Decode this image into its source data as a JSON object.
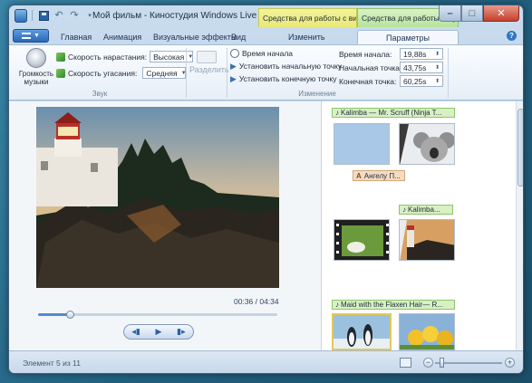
{
  "window": {
    "title": "Мой фильм - Киностудия Windows Live",
    "context_tabs": {
      "video_tools": "Средства для работы с видео",
      "music_tools": "Средства для работы с муз..."
    }
  },
  "tabs": [
    {
      "label": "Главная",
      "active": false
    },
    {
      "label": "Анимация",
      "active": false
    },
    {
      "label": "Визуальные эффекты",
      "active": false
    },
    {
      "label": "Вид",
      "active": false
    },
    {
      "label": "Изменить",
      "active": false
    },
    {
      "label": "Параметры",
      "active": true
    }
  ],
  "ribbon": {
    "sound_group": {
      "label": "Звук",
      "volume_label": "Громкость музыки",
      "fade_in_label": "Скорость нарастания:",
      "fade_in_value": "Высокая",
      "fade_out_label": "Скорость угасания:",
      "fade_out_value": "Средняя"
    },
    "split_label": "Разделить",
    "edit_group": {
      "label": "Изменение",
      "start_time_label": "Время начала",
      "set_start_label": "Установить начальную точку",
      "set_end_label": "Установить конечную точку"
    },
    "params": {
      "start_time_label": "Время начала:",
      "start_time_value": "19,88s",
      "start_point_label": "Начальная точка:",
      "start_point_value": "43,75s",
      "end_point_label": "Конечная точка:",
      "end_point_value": "60,25s"
    }
  },
  "preview": {
    "timecode": "00:36 / 04:34",
    "progress": 0.131
  },
  "storyboard": {
    "music_1": "Kalimba — Mr. Scruff (Ninja T...",
    "title_1": "Ангелу П...",
    "music_2": "Kalimba...",
    "music_3": "Maid with the Flaxen Hair— R..."
  },
  "status": {
    "text": "Элемент 5 из 11",
    "zoom_level": 0.1
  },
  "colors": {
    "accent": "#2a67b6",
    "video_tools": "#f4f39a",
    "music_tools": "#b8e39c",
    "selection": "#e3c85a"
  }
}
